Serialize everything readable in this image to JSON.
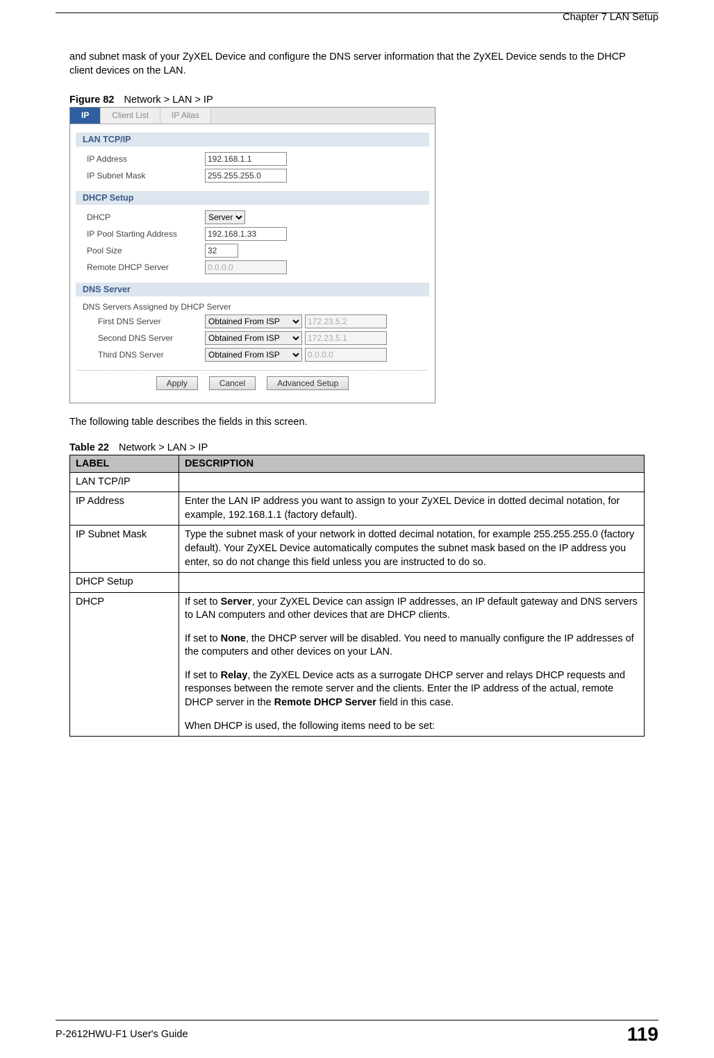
{
  "header": {
    "chapter": "Chapter 7 LAN Setup"
  },
  "body": {
    "intro": "and subnet mask of your ZyXEL Device and configure the DNS server information that the ZyXEL Device sends to the DHCP client devices on the LAN.",
    "after_figure": "The following table describes the fields in this screen."
  },
  "figure": {
    "label": "Figure 82",
    "caption": "Network > LAN > IP"
  },
  "screenshot": {
    "tabs": {
      "ip": "IP",
      "client_list": "Client List",
      "ip_alias": "IP Alias"
    },
    "sections": {
      "lan_tcpip": "LAN TCP/IP",
      "dhcp_setup": "DHCP Setup",
      "dns_server": "DNS Server"
    },
    "fields": {
      "ip_address": {
        "label": "IP Address",
        "value": "192.168.1.1"
      },
      "ip_subnet": {
        "label": "IP Subnet Mask",
        "value": "255.255.255.0"
      },
      "dhcp": {
        "label": "DHCP",
        "value": "Server"
      },
      "ip_pool": {
        "label": "IP Pool Starting Address",
        "value": "192.168.1.33"
      },
      "pool_size": {
        "label": "Pool Size",
        "value": "32"
      },
      "remote_dhcp": {
        "label": "Remote DHCP Server",
        "value": "0.0.0.0"
      },
      "dns_header": "DNS Servers Assigned by DHCP Server",
      "dns1": {
        "label": "First DNS Server",
        "select": "Obtained From ISP",
        "value": "172.23.5.2"
      },
      "dns2": {
        "label": "Second DNS Server",
        "select": "Obtained From ISP",
        "value": "172.23.5.1"
      },
      "dns3": {
        "label": "Third DNS Server",
        "select": "Obtained From ISP",
        "value": "0.0.0.0"
      }
    },
    "buttons": {
      "apply": "Apply",
      "cancel": "Cancel",
      "advanced": "Advanced Setup"
    }
  },
  "table": {
    "label": "Table 22",
    "caption": "Network > LAN > IP",
    "headers": {
      "label": "LABEL",
      "description": "DESCRIPTION"
    },
    "rows": {
      "lan_tcpip": {
        "label": "LAN TCP/IP",
        "desc": ""
      },
      "ip_address": {
        "label": "IP Address",
        "desc": "Enter the LAN IP address you want to assign to your ZyXEL Device in dotted decimal notation, for example, 192.168.1.1 (factory default)."
      },
      "ip_subnet": {
        "label": "IP Subnet Mask",
        "desc": "Type the subnet mask of your network in dotted decimal notation, for example 255.255.255.0 (factory default). Your ZyXEL Device automatically computes the subnet mask based on the IP address you enter, so do not change this field unless you are instructed to do so."
      },
      "dhcp_setup": {
        "label": "DHCP Setup",
        "desc": ""
      },
      "dhcp": {
        "label": "DHCP",
        "p1a": "If set to ",
        "p1b_bold": "Server",
        "p1c": ", your ZyXEL Device can assign IP addresses, an IP default gateway and DNS servers to LAN computers and other devices that are DHCP clients.",
        "p2a": "If set to ",
        "p2b_bold": "None",
        "p2c": ", the DHCP server will be disabled. You need to manually configure the IP addresses of the computers and other devices on your LAN.",
        "p3a": "If set to ",
        "p3b_bold": "Relay",
        "p3c": ", the ZyXEL Device acts as a surrogate DHCP server and relays DHCP requests and responses between the remote server and the clients. Enter the IP address of the actual, remote DHCP server in the ",
        "p3d_bold": "Remote DHCP Server",
        "p3e": " field in this case.",
        "p4": "When DHCP is used, the following items need to be set:"
      }
    }
  },
  "footer": {
    "guide": "P-2612HWU-F1 User's Guide",
    "page": "119"
  }
}
